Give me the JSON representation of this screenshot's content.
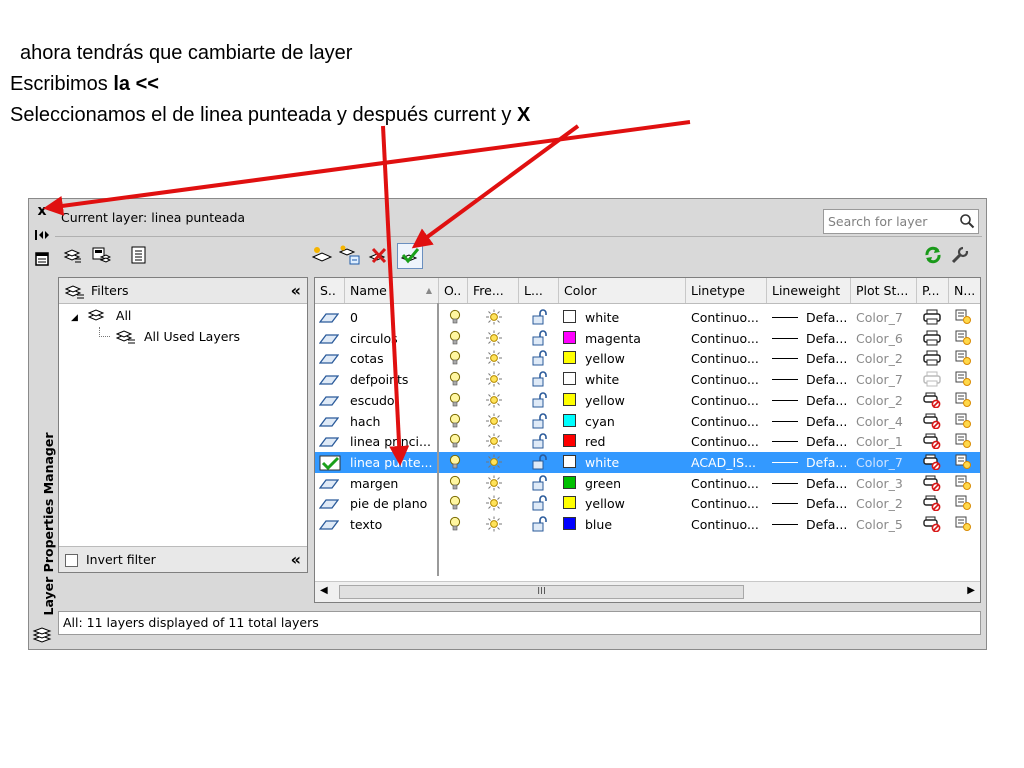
{
  "instructions": {
    "line1": "ahora tendrás que cambiarte de layer",
    "line2_prefix": "Escribimos ",
    "line2_bold": "la <<",
    "line3_prefix": "Seleccionamos el de linea punteada y después current y ",
    "line3_bold": "X"
  },
  "palette": {
    "title": "Layer Properties Manager",
    "current_layer_label": "Current layer: linea punteada",
    "search_placeholder": "Search for layer",
    "close_glyph": "x"
  },
  "filters": {
    "header": "Filters",
    "items": [
      {
        "label": "All"
      },
      {
        "label": "All Used Layers"
      }
    ],
    "invert_label": "Invert filter"
  },
  "grid": {
    "columns": [
      "S..",
      "Name",
      "O..",
      "Fre...",
      "L...",
      "Color",
      "Linetype",
      "Lineweight",
      "Plot St...",
      "P...",
      "N..."
    ],
    "scroll_thumb": "III",
    "rows": [
      {
        "name": "0",
        "color": "white",
        "hex": "#ffffff",
        "linetype": "Continuo...",
        "lineweight": "Defa...",
        "plot_style": "Color_7",
        "current": false,
        "selected": false,
        "plot": "printer"
      },
      {
        "name": "circulos",
        "color": "magenta",
        "hex": "#ff00ff",
        "linetype": "Continuo...",
        "lineweight": "Defa...",
        "plot_style": "Color_6",
        "current": false,
        "selected": false,
        "plot": "printer"
      },
      {
        "name": "cotas",
        "color": "yellow",
        "hex": "#ffff00",
        "linetype": "Continuo...",
        "lineweight": "Defa...",
        "plot_style": "Color_2",
        "current": false,
        "selected": false,
        "plot": "printer"
      },
      {
        "name": "defpoints",
        "color": "white",
        "hex": "#ffffff",
        "linetype": "Continuo...",
        "lineweight": "Defa...",
        "plot_style": "Color_7",
        "current": false,
        "selected": false,
        "plot": "printer-off"
      },
      {
        "name": "escudo",
        "color": "yellow",
        "hex": "#ffff00",
        "linetype": "Continuo...",
        "lineweight": "Defa...",
        "plot_style": "Color_2",
        "current": false,
        "selected": false,
        "plot": "printer-no"
      },
      {
        "name": "hach",
        "color": "cyan",
        "hex": "#00ffff",
        "linetype": "Continuo...",
        "lineweight": "Defa...",
        "plot_style": "Color_4",
        "current": false,
        "selected": false,
        "plot": "printer-no"
      },
      {
        "name": "linea princi...",
        "color": "red",
        "hex": "#ff0000",
        "linetype": "Continuo...",
        "lineweight": "Defa...",
        "plot_style": "Color_1",
        "current": false,
        "selected": false,
        "plot": "printer-no"
      },
      {
        "name": "linea punte...",
        "color": "white",
        "hex": "#ffffff",
        "linetype": "ACAD_IS...",
        "lineweight": "Defa...",
        "plot_style": "Color_7",
        "current": true,
        "selected": true,
        "plot": "printer-no"
      },
      {
        "name": "margen",
        "color": "green",
        "hex": "#00c000",
        "linetype": "Continuo...",
        "lineweight": "Defa...",
        "plot_style": "Color_3",
        "current": false,
        "selected": false,
        "plot": "printer-no"
      },
      {
        "name": "pie de plano",
        "color": "yellow",
        "hex": "#ffff00",
        "linetype": "Continuo...",
        "lineweight": "Defa...",
        "plot_style": "Color_2",
        "current": false,
        "selected": false,
        "plot": "printer-no"
      },
      {
        "name": "texto",
        "color": "blue",
        "hex": "#0000ff",
        "linetype": "Continuo...",
        "lineweight": "Defa...",
        "plot_style": "Color_5",
        "current": false,
        "selected": false,
        "plot": "printer-no"
      }
    ]
  },
  "status": "All: 11 layers displayed of 11 total layers",
  "colors": {
    "selection": "#3399ff",
    "annotation_arrow": "#e01010"
  }
}
